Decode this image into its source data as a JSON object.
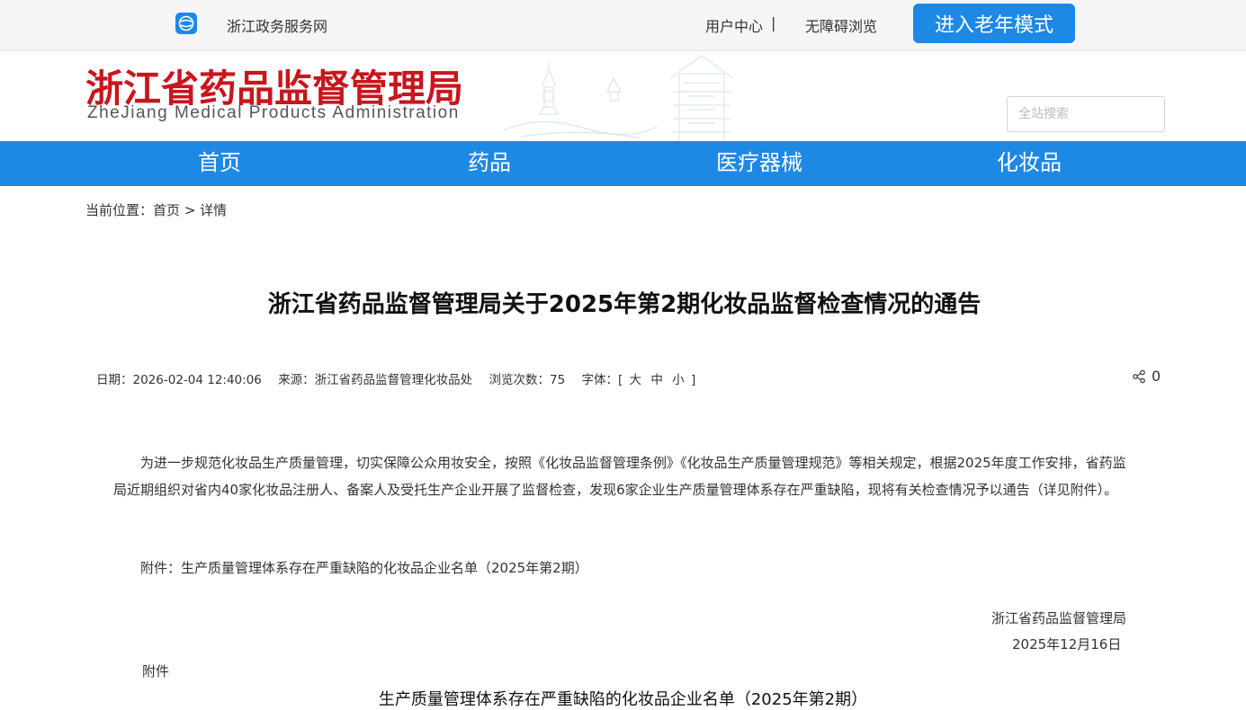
{
  "topbar": {
    "gov_portal": "浙江政务服务网",
    "user_center": "用户中心",
    "separator": "|",
    "accessible": "无障碍浏览",
    "elder_mode": "进入老年模式"
  },
  "header": {
    "title": "浙江省药品监督管理局",
    "subtitle": "ZheJiang Medical Products Administration",
    "search_placeholder": "全站搜索"
  },
  "nav": {
    "items": [
      "首页",
      "药品",
      "医疗器械",
      "化妆品"
    ]
  },
  "breadcrumb": {
    "prefix": "当前位置：",
    "home": "首页",
    "arrow": ">",
    "current": "详情"
  },
  "article": {
    "title": "浙江省药品监督管理局关于2025年第2期化妆品监督检查情况的通告",
    "meta": {
      "date": "日期：2026-02-04 12:40:06",
      "source": "来源：浙江省药品监督管理化妆品处",
      "views": "浏览次数：75",
      "font_label": "字体：[",
      "font_large": "大",
      "font_medium": "中",
      "font_small": "小",
      "font_end": "]"
    },
    "share_count": "0",
    "paragraph1": "为进一步规范化妆品生产质量管理，切实保障公众用妆安全，按照《化妆品监督管理条例》《化妆品生产质量管理规范》等相关规定，根据2025年度工作安排，省药监局近期组织对省内40家化妆品注册人、备案人及受托生产企业开展了监督检查，发现6家企业生产质量管理体系存在严重缺陷，现将有关检查情况予以通告（详见附件）。",
    "paragraph2": "附件：生产质量管理体系存在严重缺陷的化妆品企业名单（2025年第2期）",
    "sign_org": "浙江省药品监督管理局",
    "sign_date": "2025年12月16日",
    "attachment_label": "附件",
    "attachment_title": "生产质量管理体系存在严重缺陷的化妆品企业名单（2025年第2期）"
  },
  "colors": {
    "brand_blue": "#1e88e5",
    "title_red": "#c8161d"
  }
}
